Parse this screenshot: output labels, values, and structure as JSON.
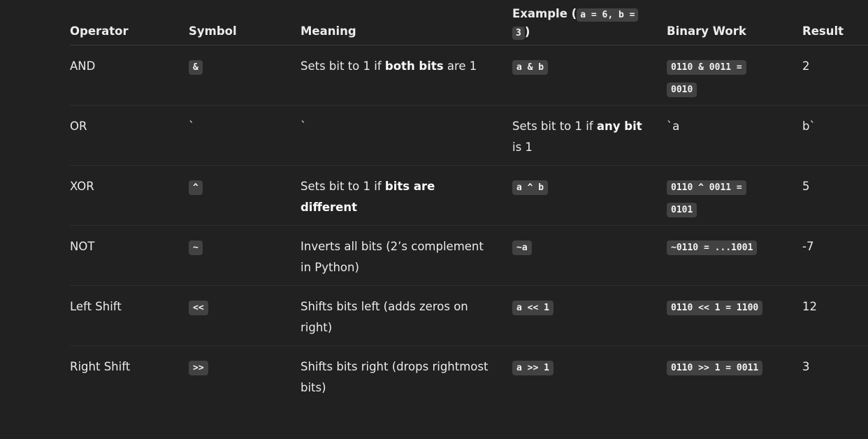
{
  "header": {
    "operator": "Operator",
    "symbol": "Symbol",
    "meaning": "Meaning",
    "example_prefix": "Example (",
    "example_code_1": "a = 6, b =",
    "example_code_2": "3",
    "example_suffix": ")",
    "binary_work": "Binary Work",
    "result": "Result"
  },
  "rows": [
    {
      "operator": "AND",
      "symbol": "&",
      "meaning_pre": "Sets bit to 1 if ",
      "meaning_bold": "both bits",
      "meaning_post": " are 1",
      "example": "a & b",
      "binary_1": "0110 & 0011 =",
      "binary_2": "0010",
      "result": "2"
    },
    {
      "operator": "OR",
      "symbol": "`",
      "meaning": "`",
      "example_pre": "Sets bit to 1 if ",
      "example_bold": "any bit",
      "example_post": " is 1",
      "binary": "`a",
      "result": "b`"
    },
    {
      "operator": "XOR",
      "symbol": "^",
      "meaning_pre": "Sets bit to 1 if ",
      "meaning_bold": "bits are different",
      "example": "a ^ b",
      "binary_1": "0110 ^ 0011 =",
      "binary_2": "0101",
      "result": "5"
    },
    {
      "operator": "NOT",
      "symbol": "~",
      "meaning": "Inverts all bits (2’s complement in Python)",
      "example": "~a",
      "binary": "~0110 = ...1001",
      "result": "-7"
    },
    {
      "operator": "Left Shift",
      "symbol": "<<",
      "meaning": "Shifts bits left (adds zeros on right)",
      "example": "a << 1",
      "binary": "0110 << 1 = 1100",
      "result": "12"
    },
    {
      "operator": "Right Shift",
      "symbol": ">>",
      "meaning": "Shifts bits right (drops rightmost bits)",
      "example": "a >> 1",
      "binary": "0110 >> 1 = 0011",
      "result": "3"
    }
  ]
}
